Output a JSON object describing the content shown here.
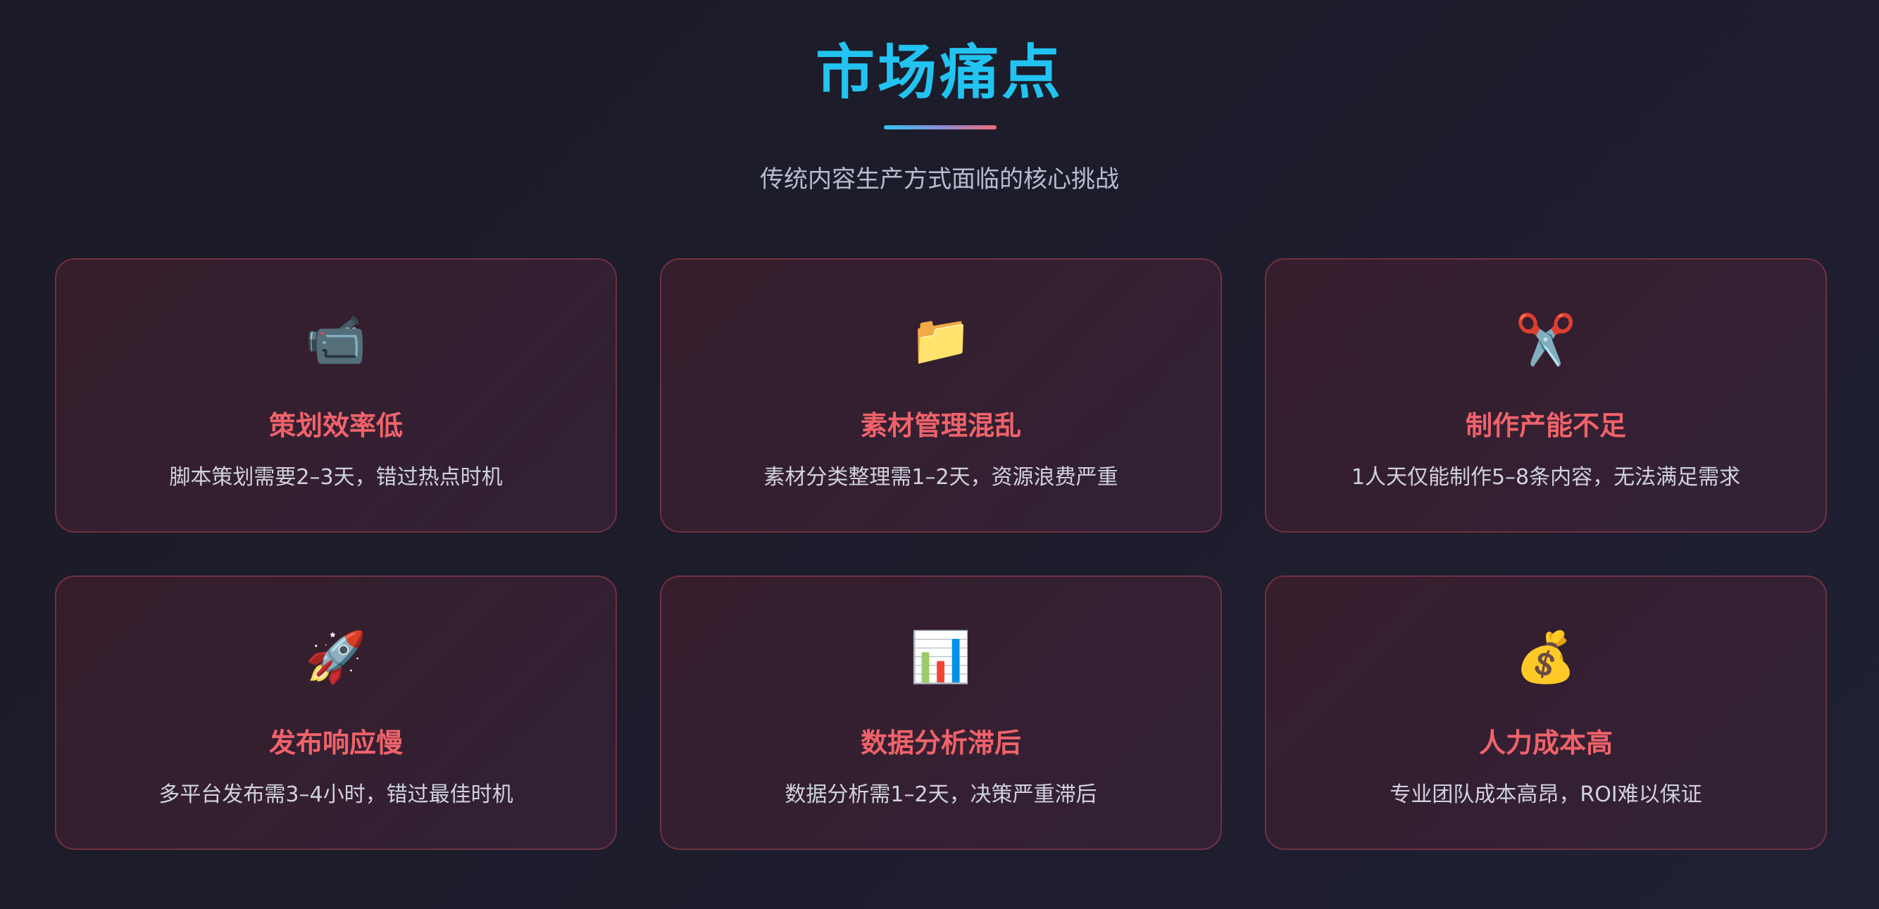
{
  "header": {
    "title": "市场痛点",
    "subtitle": "传统内容生产方式面临的核心挑战"
  },
  "cards": [
    {
      "icon": "📹",
      "icon_name": "video-camera-icon",
      "title": "策划效率低",
      "description": "脚本策划需要2–3天，错过热点时机"
    },
    {
      "icon": "📁",
      "icon_name": "folder-icon",
      "title": "素材管理混乱",
      "description": "素材分类整理需1–2天，资源浪费严重"
    },
    {
      "icon": "✂️",
      "icon_name": "scissors-icon",
      "title": "制作产能不足",
      "description": "1人天仅能制作5–8条内容，无法满足需求"
    },
    {
      "icon": "🚀",
      "icon_name": "rocket-icon",
      "title": "发布响应慢",
      "description": "多平台发布需3–4小时，错过最佳时机"
    },
    {
      "icon": "📊",
      "icon_name": "bar-chart-icon",
      "title": "数据分析滞后",
      "description": "数据分析需1–2天，决策严重滞后"
    },
    {
      "icon": "💰",
      "icon_name": "money-bag-icon",
      "title": "人力成本高",
      "description": "专业团队成本高昂，ROI难以保证"
    }
  ],
  "colors": {
    "title": "#22c3f0",
    "card_title": "#f0626a",
    "card_border": "#d65060",
    "background": "#1c1c2a"
  }
}
